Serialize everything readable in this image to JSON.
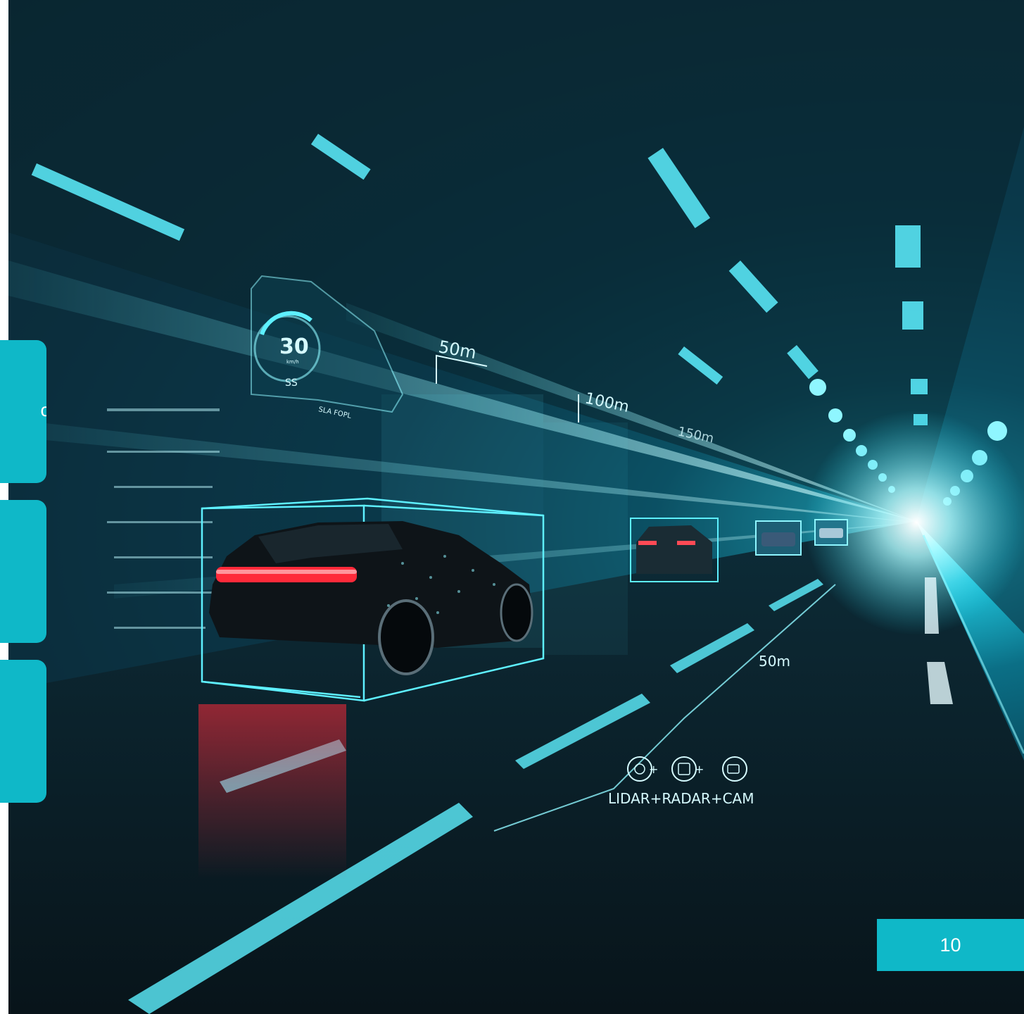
{
  "photo": {
    "hud": {
      "speed_value": "30",
      "speed_unit": "km/h",
      "speed_sub": "SS",
      "speed_caption": "SLA FOPL",
      "distance_labels": [
        "50m",
        "100m",
        "150m",
        "50m"
      ],
      "sensor_caption": "LIDAR+RADAR+CAM",
      "sensor_icons": [
        "lidar-icon",
        "radar-icon",
        "camera-icon"
      ]
    }
  },
  "cards": [
    {
      "glyph": "o"
    },
    {
      "glyph": ""
    },
    {
      "glyph": ""
    }
  ],
  "page_number": "10",
  "colors": {
    "accent": "#0fb8c8",
    "hud_glow": "#5ef0ff",
    "tail_light": "#ff2a3a"
  }
}
